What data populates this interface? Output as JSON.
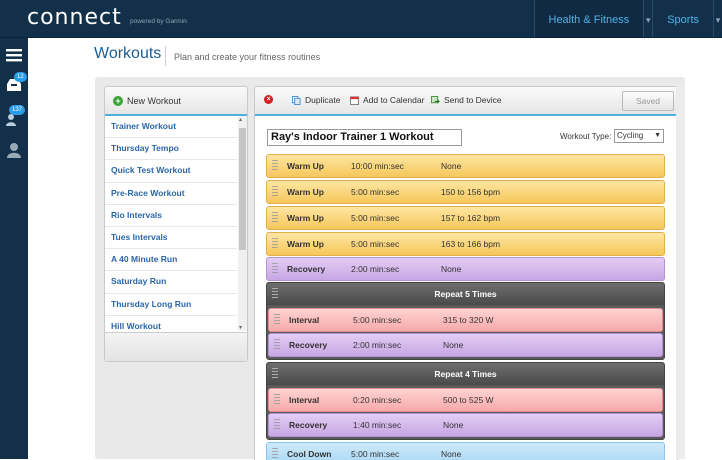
{
  "brand": {
    "logo": "connect",
    "powered_by": "powered by Garmin"
  },
  "topnav": {
    "health_fitness": "Health & Fitness",
    "sports": "Sports"
  },
  "sidebar": {
    "inbox_count": "12",
    "connections_count": "137"
  },
  "page": {
    "title": "Workouts",
    "subtitle": "Plan and create your fitness routines"
  },
  "left_panel": {
    "new_workout": "New Workout",
    "workouts": [
      "Trainer Workout",
      "Thursday Tempo",
      "Quick Test Workout",
      "Pre-Race Workout",
      "Rio Intervals",
      "Tues Intervals",
      "A 40 Minute Run",
      "Saturday Run",
      "Thursday Long Run",
      "Hill Workout"
    ]
  },
  "toolbar": {
    "duplicate": "Duplicate",
    "add_to_calendar": "Add to Calendar",
    "send_to_device": "Send to Device",
    "saved": "Saved"
  },
  "workout": {
    "name": "Ray's Indoor Trainer 1 Workout",
    "type_label": "Workout Type:",
    "type_value": "Cycling",
    "steps": [
      {
        "type": "Warm Up",
        "duration": "10:00 min:sec",
        "target": "None"
      },
      {
        "type": "Warm Up",
        "duration": "5:00 min:sec",
        "target": "150 to 156 bpm"
      },
      {
        "type": "Warm Up",
        "duration": "5:00 min:sec",
        "target": "157 to 162 bpm"
      },
      {
        "type": "Warm Up",
        "duration": "5:00 min:sec",
        "target": "163 to 166 bpm"
      },
      {
        "type": "Recovery",
        "duration": "2:00 min:sec",
        "target": "None"
      }
    ],
    "repeats": [
      {
        "label": "Repeat 5 Times",
        "steps": [
          {
            "type": "Interval",
            "duration": "5:00 min:sec",
            "target": "315 to 320 W"
          },
          {
            "type": "Recovery",
            "duration": "2:00 min:sec",
            "target": "None"
          }
        ]
      },
      {
        "label": "Repeat 4 Times",
        "steps": [
          {
            "type": "Interval",
            "duration": "0:20 min:sec",
            "target": "500 to 525 W"
          },
          {
            "type": "Recovery",
            "duration": "1:40 min:sec",
            "target": "None"
          }
        ]
      }
    ],
    "cooldown": {
      "type": "Cool Down",
      "duration": "5:00 min:sec",
      "target": "None"
    }
  },
  "colors": {
    "nav_bg": "#13304a",
    "accent": "#4fb0e0",
    "link": "#2a66a8",
    "warmup": "#f6c75a",
    "recovery": "#c7a6e4",
    "interval": "#f7a9a9",
    "cooldown": "#a6d7f4"
  }
}
